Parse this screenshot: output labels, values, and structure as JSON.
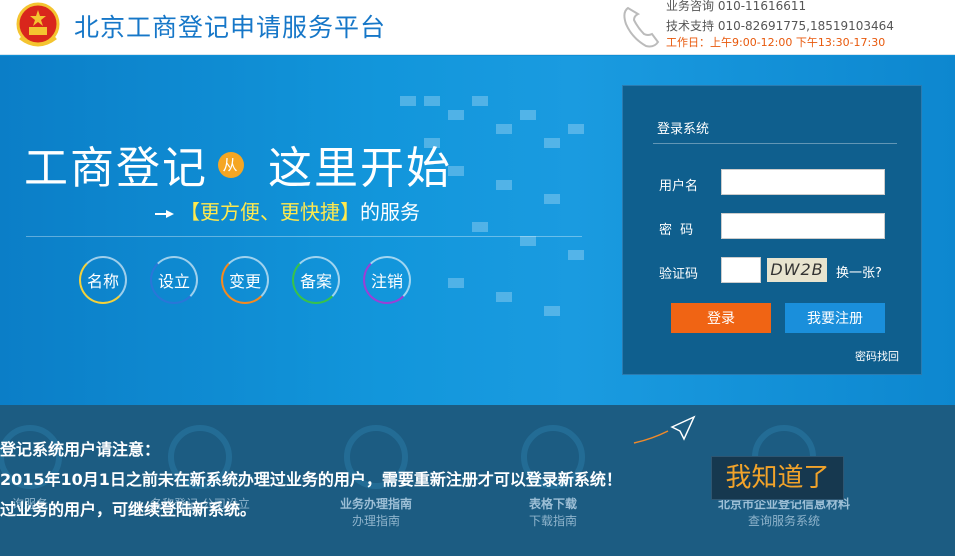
{
  "header": {
    "site_title": "北京工商登记申请服务平台",
    "hotline": "业务咨询 010-11616611",
    "support": "技术支持 010-82691775,18519103464",
    "hours": "工作日：上午9:00-12:00  下午13:30-17:30"
  },
  "hero": {
    "slogan_part1": "工商登记",
    "badge": "从",
    "slogan_part2": "这里开始",
    "tagline_bracket": "【更方便、更快捷】",
    "tagline_suffix": "的服务",
    "circle_buttons": [
      {
        "label": "名称",
        "color": "#f5d23a"
      },
      {
        "label": "设立",
        "color": "#2a76d8"
      },
      {
        "label": "变更",
        "color": "#f58a1f"
      },
      {
        "label": "备案",
        "color": "#38c24a"
      },
      {
        "label": "注销",
        "color": "#9b3fd6"
      }
    ]
  },
  "login": {
    "title": "登录系统",
    "username_label": "用户名",
    "password_label": "密  码",
    "captcha_label": "验证码",
    "captcha_image_text": "DW2B",
    "change_captcha": "换一张?",
    "login_button": "登录",
    "register_button": "我要注册",
    "forgot_password": "密码找回"
  },
  "services": [
    {
      "title": "",
      "sub": "询服务"
    },
    {
      "title": "",
      "sub": "名称登记    公司设立"
    },
    {
      "title": "业务办理指南",
      "sub": "办理指南"
    },
    {
      "title": "表格下载",
      "sub": "下载指南"
    },
    {
      "title": "北京市企业登记信息材料",
      "sub": "查询服务系统"
    }
  ],
  "notice": {
    "line1": "登记系统用户请注意：",
    "line2": "2015年10月1日之前未在新系统办理过业务的用户，需要重新注册才可以登录新系统！",
    "line3": "过业务的用户，可继续登陆新系统。",
    "dismiss_button": "我知道了"
  },
  "colors": {
    "brand_blue": "#1677c8",
    "login_orange": "#f06414",
    "register_blue": "#1a8fdb",
    "dismiss_text": "#f2a32a"
  }
}
